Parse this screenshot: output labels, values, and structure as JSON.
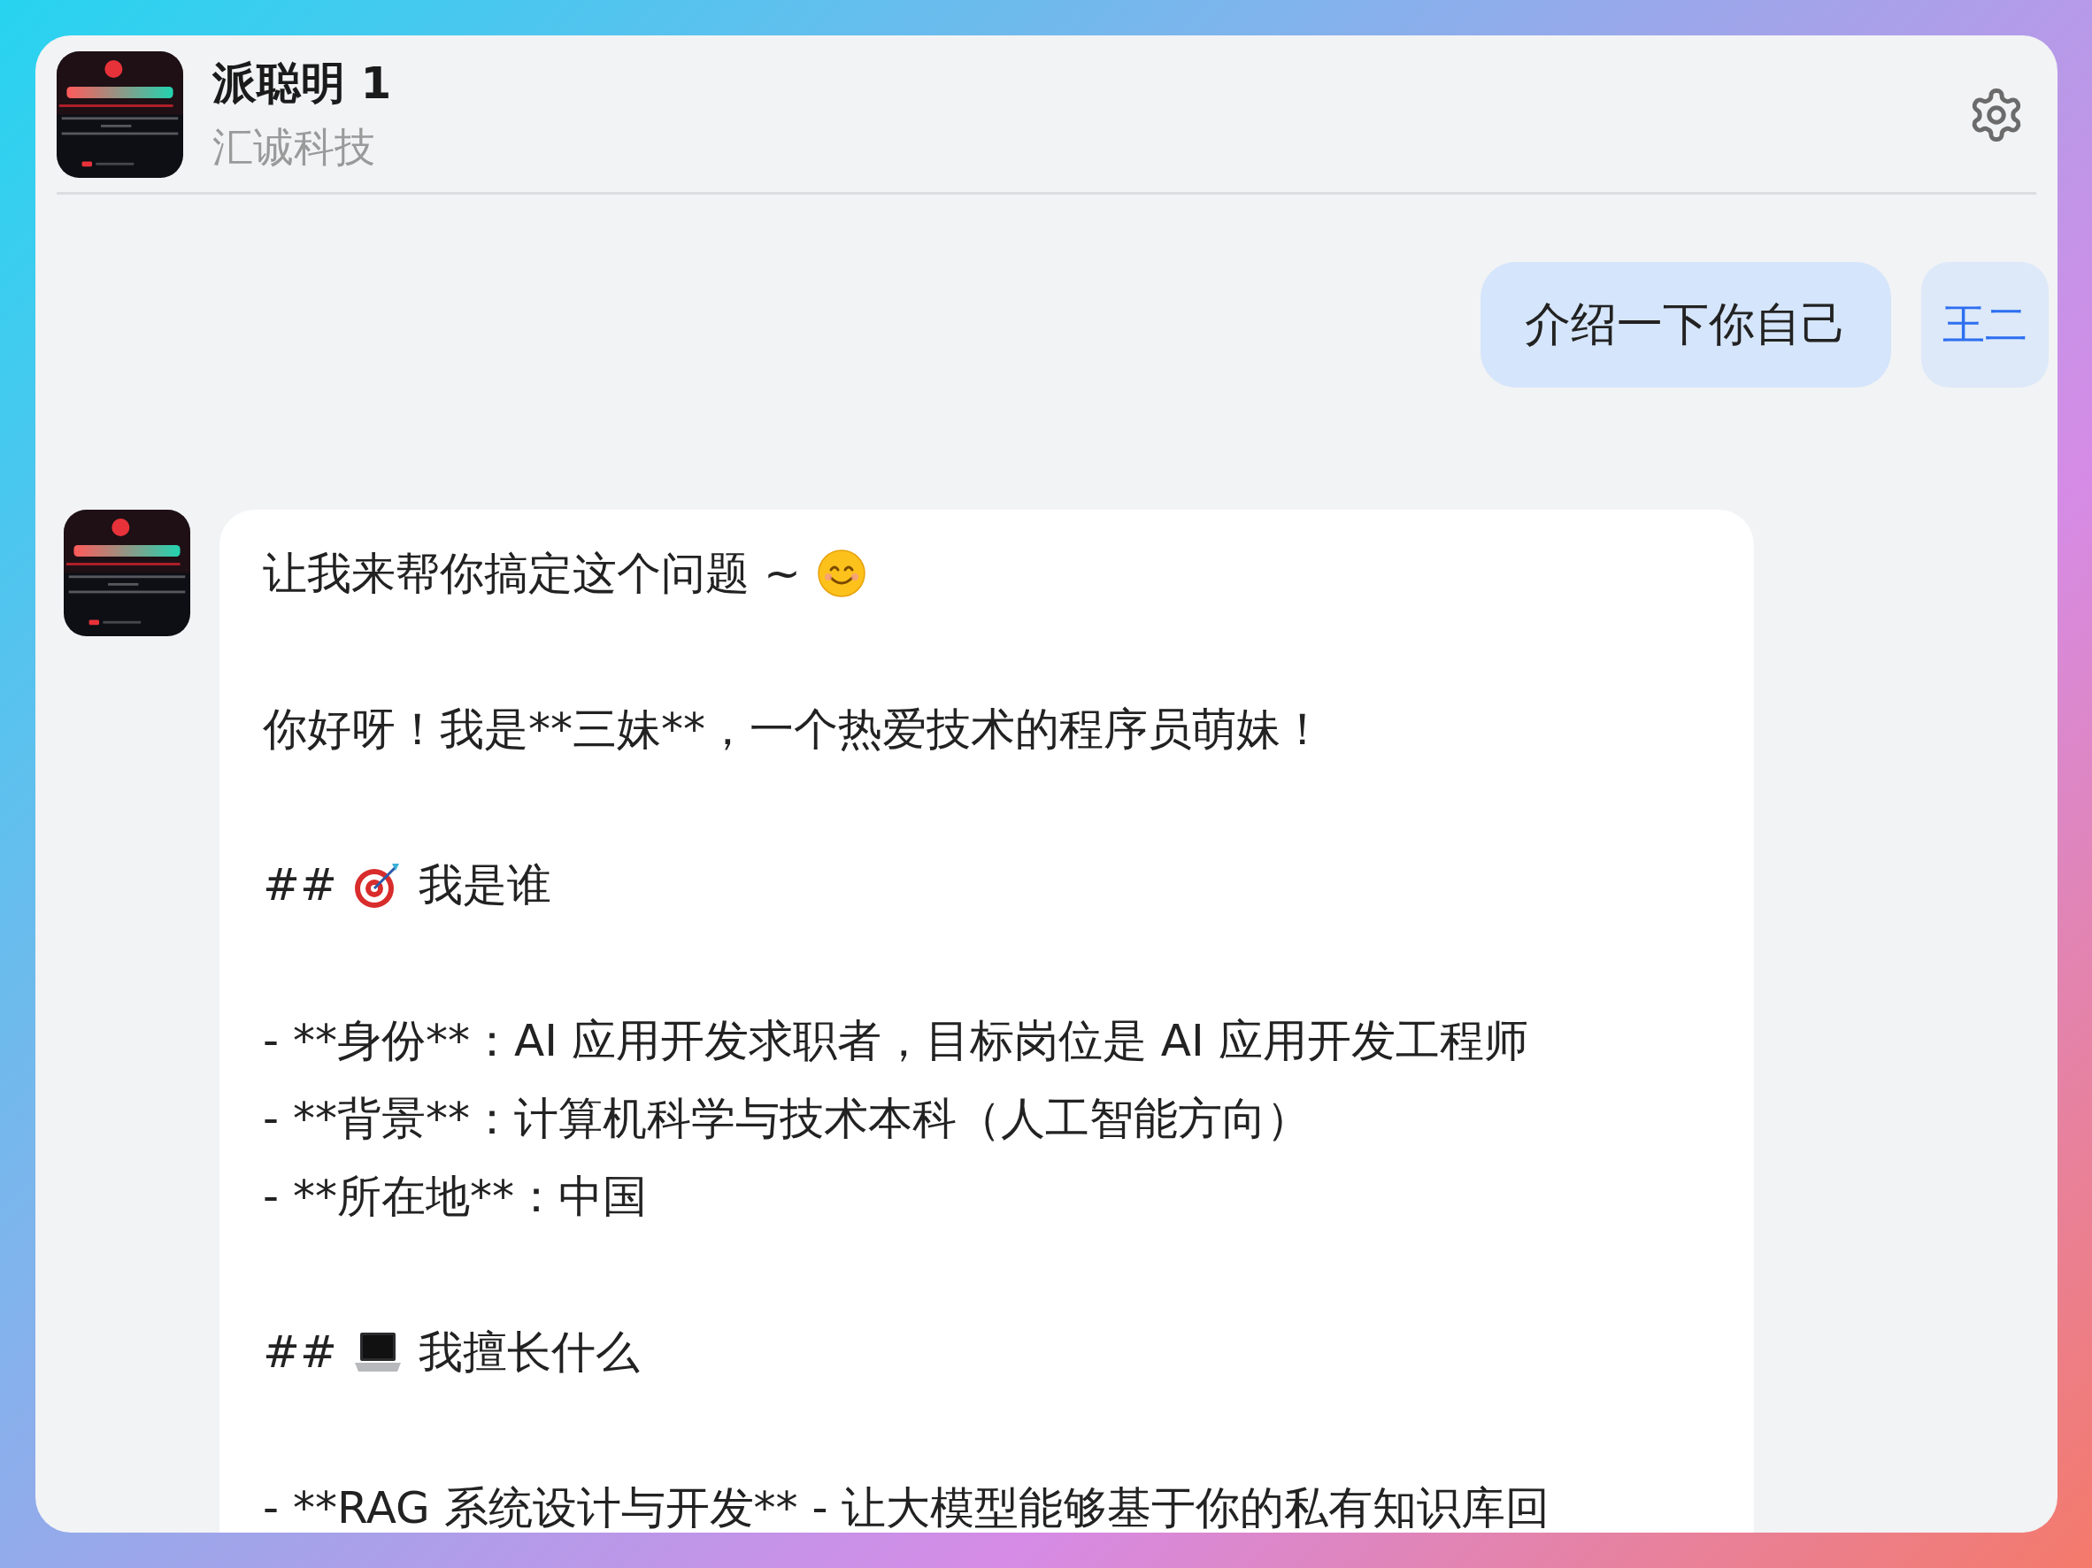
{
  "header": {
    "title": "派聪明 1",
    "subtitle": "汇诚科技"
  },
  "messages": [
    {
      "kind": "user",
      "text": "介绍一下你自己",
      "sender": "王二"
    },
    {
      "kind": "bot",
      "blocks": [
        {
          "kind": "greeting",
          "text": "让我来帮你搞定这个问题 ~"
        },
        {
          "kind": "paragraph",
          "text": "你好呀！我是**三妹**，一个热爱技术的程序员萌妹！"
        },
        {
          "kind": "heading",
          "marker": "##",
          "text": "我是谁"
        },
        {
          "kind": "list",
          "items": [
            "- **身份**：AI 应用开发求职者，目标岗位是 AI 应用开发工程师",
            "- **背景**：计算机科学与技术本科（人工智能方向）",
            "- **所在地**：中国"
          ]
        },
        {
          "kind": "heading",
          "marker": "##",
          "text": "我擅长什么"
        },
        {
          "kind": "list",
          "items": [
            "- **RAG 系统设计与开发** - 让大模型能够基于你的私有知识库回"
          ]
        }
      ]
    }
  ]
}
